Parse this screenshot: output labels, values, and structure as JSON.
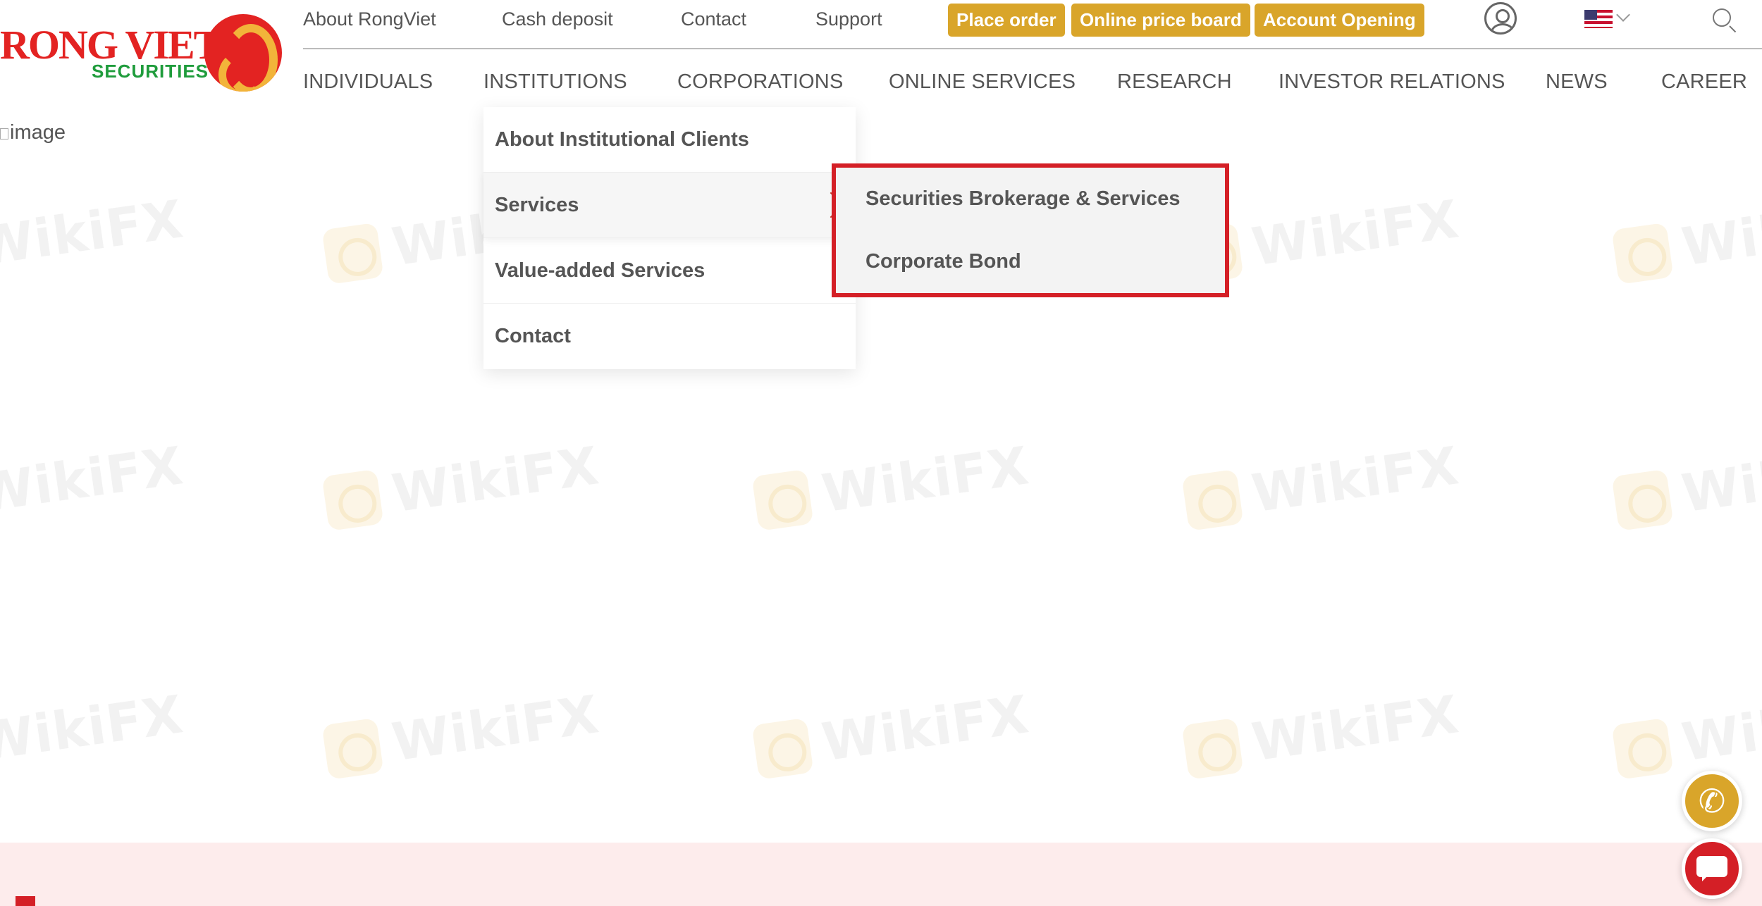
{
  "brand": {
    "name": "RONG VIET",
    "subtitle": "SECURITIES",
    "primary_color": "#e32322",
    "secondary_color": "#1f9c3c",
    "accent_color": "#d9a52a"
  },
  "topbar": {
    "links": [
      "About RongViet",
      "Cash deposit",
      "Contact",
      "Support"
    ],
    "buttons": [
      "Place order",
      "Online price board",
      "Account Opening"
    ],
    "icons": [
      "user-icon",
      "us-flag-icon",
      "chevron-down-icon",
      "search-icon"
    ]
  },
  "mainnav": {
    "items": [
      "INDIVIDUALS",
      "INSTITUTIONS",
      "CORPORATIONS",
      "ONLINE SERVICES",
      "RESEARCH",
      "INVESTOR RELATIONS",
      "NEWS",
      "CAREER"
    ],
    "active": "INSTITUTIONS"
  },
  "content": {
    "broken_image_alt": "image"
  },
  "dropdown": {
    "items": [
      "About Institutional Clients",
      "Services",
      "Value-added Services",
      "Contact"
    ],
    "active": "Services"
  },
  "submenu": {
    "items": [
      "Securities Brokerage & Services",
      "Corporate Bond"
    ],
    "highlight_color": "#d41f26"
  },
  "watermark": {
    "text": "WikiFX"
  },
  "floating": {
    "call_icon": "phone-icon",
    "chat_icon": "chat-icon"
  }
}
